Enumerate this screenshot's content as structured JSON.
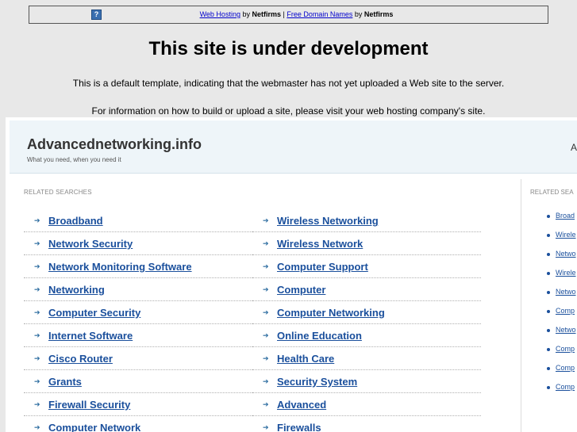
{
  "banner": {
    "icon_symbol": "?",
    "link1": "Web Hosting",
    "by1": " by ",
    "brand1": "Netfirms",
    "separator": " | ",
    "link2": "Free Domain Names",
    "by2": " by ",
    "brand2": "Netfirms"
  },
  "dev": {
    "title": "This site is under development",
    "line1": "This is a default template, indicating that the webmaster has not yet uploaded a Web site to the server.",
    "line2": "For information on how to build or upload a site, please visit your web hosting company's site."
  },
  "parked": {
    "site_name": "Advancednetworking.info",
    "tagline": "What you need, when you need it",
    "header_right_mark": "A",
    "related_label": "RELATED SEARCHES",
    "related_label_right": "RELATED SEA",
    "left_links": [
      "Broadband",
      "Network Security",
      "Network Monitoring Software",
      "Networking",
      "Computer Security",
      "Internet Software",
      "Cisco Router",
      "Grants",
      "Firewall Security",
      "Computer Network"
    ],
    "right_links": [
      "Wireless Networking",
      "Wireless Network",
      "Computer Support",
      "Computer",
      "Computer Networking",
      "Online Education",
      "Health Care",
      "Security System",
      "Advanced",
      "Firewalls"
    ],
    "side_links": [
      "Broad",
      "Wirele",
      "Netwo",
      "Wirele",
      "Netwo",
      "Comp",
      "Netwo",
      "Comp",
      "Comp",
      "Comp"
    ]
  },
  "colors": {
    "link": "#1a4f9c",
    "banner_link": "#0000cc",
    "header_bg": "#eef5f9",
    "page_bg": "#e8e8e8"
  }
}
